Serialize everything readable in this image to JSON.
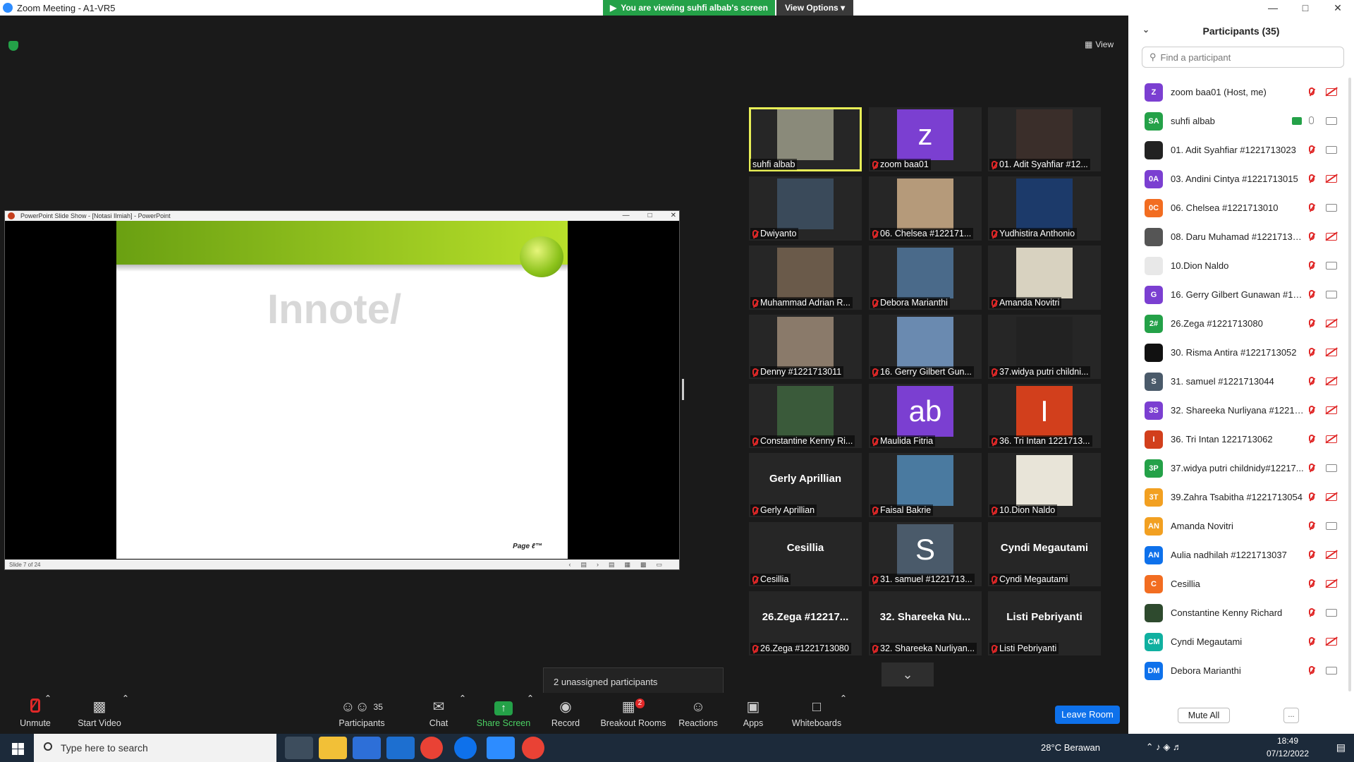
{
  "window": {
    "title": "Zoom Meeting - A1-VR5"
  },
  "banner": {
    "viewing_text": "You are viewing suhfi albab's screen",
    "view_options": "View Options"
  },
  "stage": {
    "view_label": "View"
  },
  "ppt": {
    "title": "PowerPoint Slide Show - [Notasi Ilmiah] - PowerPoint",
    "slide_heading": "Innote/",
    "slide_footer": "Page ℓ™",
    "status": "Slide 7 of 24"
  },
  "gallery": [
    {
      "label": "suhfi albab",
      "kind": "photo",
      "color": "#8a8a7a",
      "active": true
    },
    {
      "label": "zoom baa01",
      "kind": "avatar",
      "initial": "z",
      "color": "#7b3fd1"
    },
    {
      "label": "01. Adit Syahfiar #12...",
      "kind": "photo",
      "color": "#3a2e2a"
    },
    {
      "label": "Dwiyanto",
      "kind": "photo",
      "color": "#3a4a5a"
    },
    {
      "label": "06. Chelsea #122171...",
      "kind": "photo",
      "color": "#b59a7a"
    },
    {
      "label": "Yudhistira Anthonio",
      "kind": "photo",
      "color": "#1c3a6a"
    },
    {
      "label": "Muhammad Adrian R...",
      "kind": "photo",
      "color": "#6a5a4a"
    },
    {
      "label": "Debora Marianthi",
      "kind": "photo",
      "color": "#4a6a8a"
    },
    {
      "label": "Amanda Novitri",
      "kind": "photo",
      "color": "#d8d2c0"
    },
    {
      "label": "Denny #1221713011",
      "kind": "photo",
      "color": "#8a7a6a"
    },
    {
      "label": "16. Gerry Gilbert Gun...",
      "kind": "photo",
      "color": "#6a8ab0"
    },
    {
      "label": "37.widya putri childni...",
      "kind": "photo",
      "color": "#222222"
    },
    {
      "label": "Constantine Kenny Ri...",
      "kind": "photo",
      "color": "#3a5a3a"
    },
    {
      "label": "Maulida Fitria",
      "kind": "avatar",
      "initial": "ab",
      "color": "#7b3fd1"
    },
    {
      "label": "36. Tri Intan 1221713...",
      "kind": "avatar",
      "initial": "I",
      "color": "#d23f1c"
    },
    {
      "label": "Gerly Aprillian",
      "kind": "name",
      "big": "Gerly Aprillian"
    },
    {
      "label": "Faisal Bakrie",
      "kind": "photo",
      "color": "#4a7aa0"
    },
    {
      "label": "10.Dion Naldo",
      "kind": "photo",
      "color": "#e8e4d8"
    },
    {
      "label": "Cesillia",
      "kind": "name",
      "big": "Cesillia"
    },
    {
      "label": "31. samuel #1221713...",
      "kind": "avatar",
      "initial": "S",
      "color": "#4a5a6a"
    },
    {
      "label": "Cyndi Megautami",
      "kind": "name",
      "big": "Cyndi Megautami"
    },
    {
      "label": "26.Zega #1221713080",
      "kind": "name",
      "big": "26.Zega #12217..."
    },
    {
      "label": "32. Shareeka Nurliyan...",
      "kind": "name",
      "big": "32. Shareeka Nu..."
    },
    {
      "label": "Listi Pebriyanti",
      "kind": "name",
      "big": "Listi Pebriyanti"
    }
  ],
  "unassigned": "2 unassigned participants",
  "toolbar": {
    "unmute": "Unmute",
    "start_video": "Start Video",
    "participants": "Participants",
    "participants_count": "35",
    "chat": "Chat",
    "share_screen": "Share Screen",
    "record": "Record",
    "breakout": "Breakout Rooms",
    "breakout_badge": "2",
    "reactions": "Reactions",
    "apps": "Apps",
    "whiteboards": "Whiteboards",
    "leave": "Leave Room"
  },
  "panel": {
    "title": "Participants (35)",
    "search_placeholder": "Find a participant",
    "mute_all": "Mute All",
    "more": "...",
    "participants": [
      {
        "initials": "Z",
        "color": "#7b3fd1",
        "name": "zoom baa01 (Host, me)",
        "video": "off"
      },
      {
        "initials": "SA",
        "color": "#24a148",
        "name": "suhfi albab",
        "video": "on",
        "sharing": true,
        "mic": "on"
      },
      {
        "initials": "",
        "color": "#222222",
        "name": "01. Adit Syahfiar #1221713023",
        "video": "on"
      },
      {
        "initials": "0A",
        "color": "#7b3fd1",
        "name": "03. Andini Cintya #1221713015",
        "video": "off"
      },
      {
        "initials": "0C",
        "color": "#f26d21",
        "name": "06. Chelsea #1221713010",
        "video": "on"
      },
      {
        "initials": "",
        "color": "#555555",
        "name": "08. Daru Muhamad #12217130...",
        "video": "off"
      },
      {
        "initials": "",
        "color": "#e8e8e8",
        "name": "10.Dion Naldo",
        "video": "on"
      },
      {
        "initials": "G",
        "color": "#7b3fd1",
        "name": "16. Gerry Gilbert Gunawan #12...",
        "video": "on"
      },
      {
        "initials": "2#",
        "color": "#24a148",
        "name": "26.Zega #1221713080",
        "video": "off"
      },
      {
        "initials": "",
        "color": "#111111",
        "name": "30. Risma Antira #1221713052",
        "video": "off"
      },
      {
        "initials": "S",
        "color": "#4a5a6a",
        "name": "31. samuel #1221713044",
        "video": "off"
      },
      {
        "initials": "3S",
        "color": "#7b3fd1",
        "name": "32. Shareeka Nurliyana #12217...",
        "video": "off"
      },
      {
        "initials": "I",
        "color": "#d23f1c",
        "name": "36. Tri Intan 1221713062",
        "video": "off"
      },
      {
        "initials": "3P",
        "color": "#24a148",
        "name": "37.widya putri childnidy#12217...",
        "video": "on"
      },
      {
        "initials": "3T",
        "color": "#f2a021",
        "name": "39.Zahra Tsabitha #1221713054",
        "video": "off"
      },
      {
        "initials": "AN",
        "color": "#f2a021",
        "name": "Amanda Novitri",
        "video": "on"
      },
      {
        "initials": "AN",
        "color": "#0e71eb",
        "name": "Aulia nadhilah #1221713037",
        "video": "off"
      },
      {
        "initials": "C",
        "color": "#f26d21",
        "name": "Cesillia",
        "video": "off"
      },
      {
        "initials": "",
        "color": "#2e4a2e",
        "name": "Constantine Kenny Richard",
        "video": "on"
      },
      {
        "initials": "CM",
        "color": "#10b0a0",
        "name": "Cyndi Megautami",
        "video": "off"
      },
      {
        "initials": "DM",
        "color": "#0e71eb",
        "name": "Debora Marianthi",
        "video": "on"
      }
    ]
  },
  "taskbar": {
    "search_placeholder": "Type here to search",
    "weather": "28°C  Berawan",
    "time": "18:49",
    "date": "07/12/2022"
  }
}
